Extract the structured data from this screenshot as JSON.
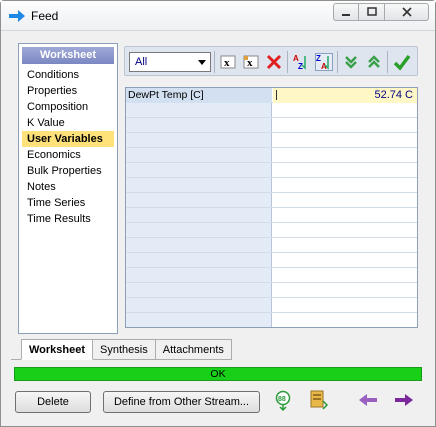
{
  "window": {
    "title": "Feed"
  },
  "nav": {
    "header": "Worksheet",
    "items": [
      {
        "label": "Conditions"
      },
      {
        "label": "Properties"
      },
      {
        "label": "Composition"
      },
      {
        "label": "K Value"
      },
      {
        "label": "User Variables",
        "active": true
      },
      {
        "label": "Economics"
      },
      {
        "label": "Bulk Properties"
      },
      {
        "label": "Notes"
      },
      {
        "label": "Time Series"
      },
      {
        "label": "Time Results"
      }
    ]
  },
  "toolbar": {
    "filter_value": "All",
    "icons": [
      "delete-x-icon",
      "delete-all-x-icon",
      "red-cross-icon",
      "sort-az-icon",
      "sort-za-icon",
      "move-down-icon",
      "move-up-icon",
      "checkmark-icon"
    ]
  },
  "grid": {
    "rows": [
      {
        "label": "DewPt Temp [C]",
        "value": "52.74 C"
      }
    ]
  },
  "tabs": [
    "Worksheet",
    "Synthesis",
    "Attachments"
  ],
  "status": {
    "text": "OK",
    "color": "#17d017"
  },
  "footer": {
    "delete_label": "Delete",
    "define_label": "Define from Other Stream..."
  }
}
